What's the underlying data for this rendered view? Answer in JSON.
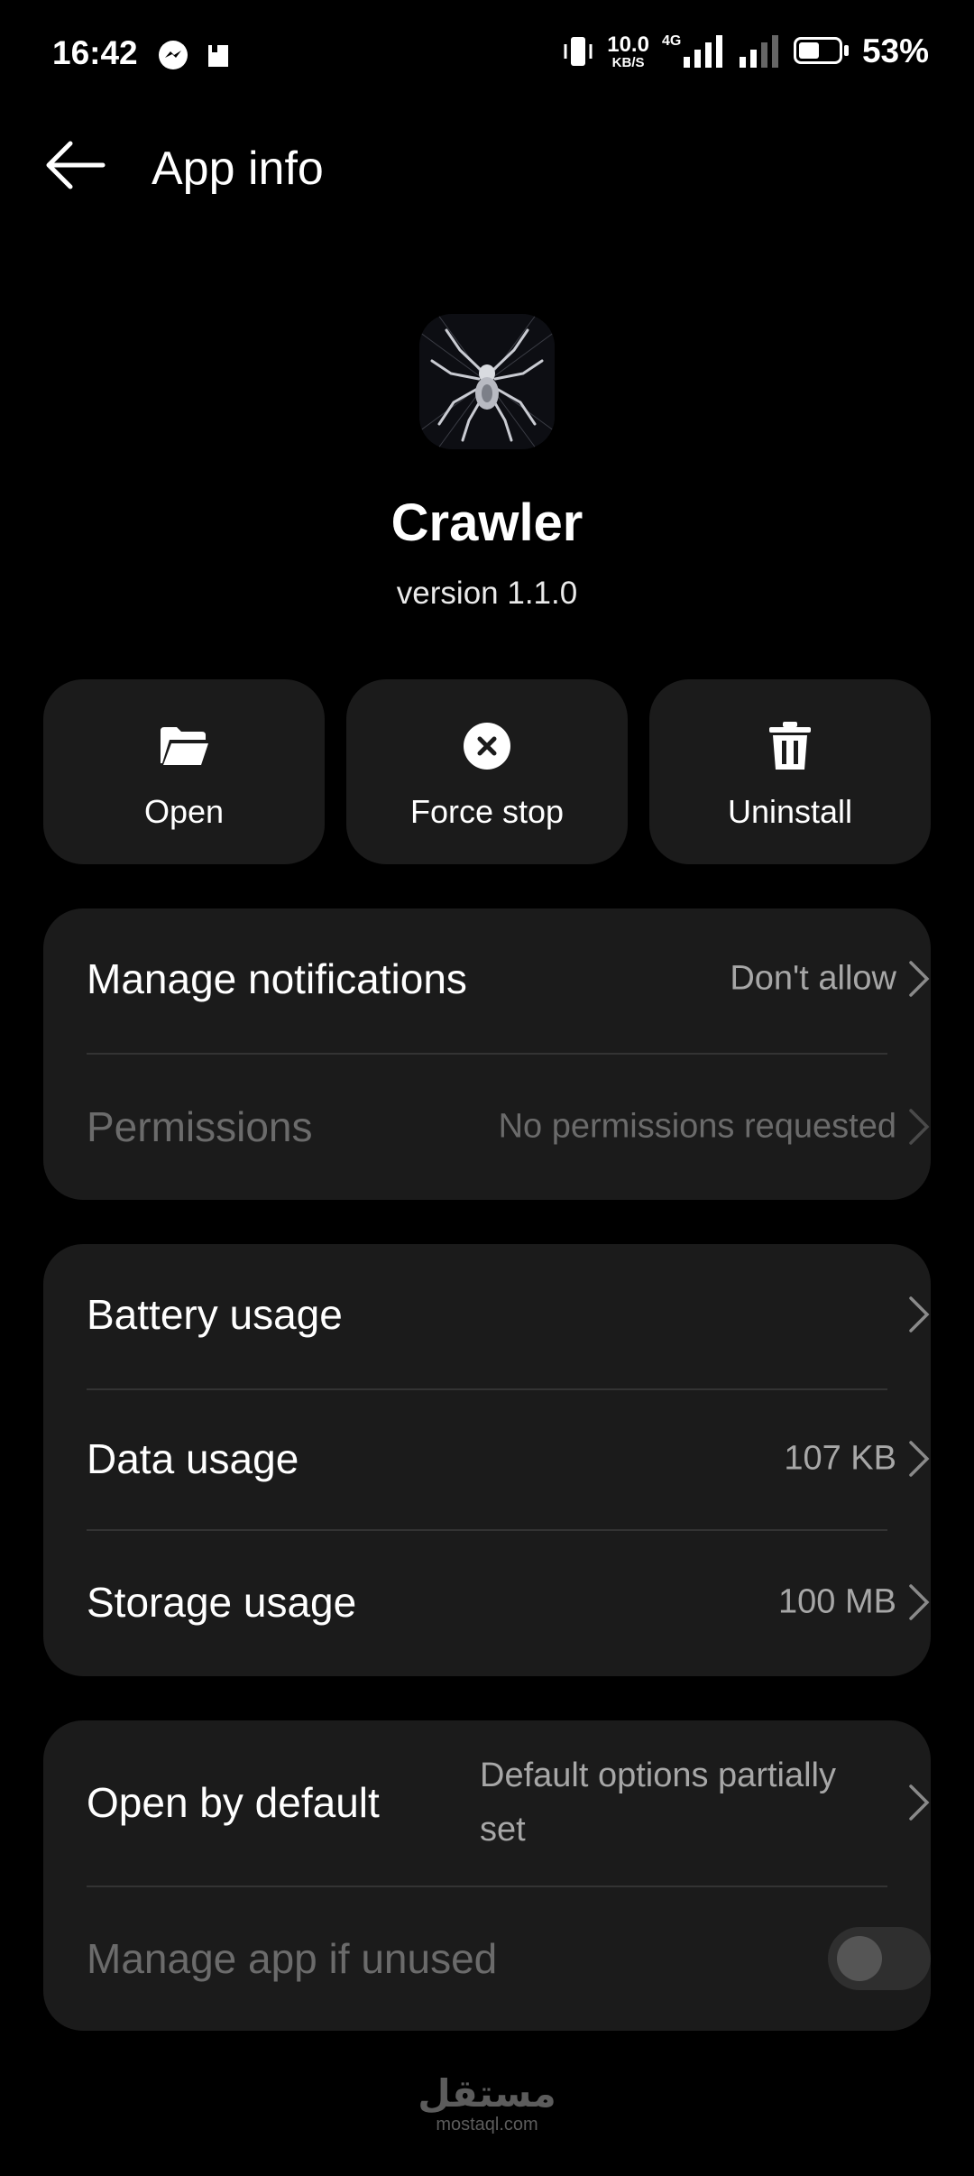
{
  "status_bar": {
    "time": "16:42",
    "left_icons": [
      "messenger-icon",
      "sim-icon"
    ],
    "net_speed_value": "10.0",
    "net_speed_unit": "KB/S",
    "network_type": "4G",
    "battery_percent": "53%",
    "battery_level": 0.53
  },
  "header": {
    "title": "App info"
  },
  "app": {
    "name": "Crawler",
    "version": "version 1.1.0",
    "icon": "spider-icon"
  },
  "actions": [
    {
      "label": "Open",
      "icon": "folder-open-icon"
    },
    {
      "label": "Force stop",
      "icon": "close-circle-icon"
    },
    {
      "label": "Uninstall",
      "icon": "trash-icon"
    }
  ],
  "card1": {
    "notifications": {
      "label": "Manage notifications",
      "value": "Don't allow"
    },
    "permissions": {
      "label": "Permissions",
      "value": "No permissions requested"
    }
  },
  "card2": {
    "battery": {
      "label": "Battery usage",
      "value": ""
    },
    "data": {
      "label": "Data usage",
      "value": "107 KB"
    },
    "storage": {
      "label": "Storage usage",
      "value": "100 MB"
    }
  },
  "card3": {
    "open_default": {
      "label": "Open by default",
      "value_line1": "Default options partially",
      "value_line2": "set"
    },
    "manage_unused": {
      "label": "Manage app if unused",
      "enabled": false
    }
  },
  "watermark": {
    "arabic": "مستقل",
    "latin": "mostaql.com"
  },
  "colors": {
    "background": "#000000",
    "card": "#1b1b1b",
    "secondary_text": "#a7a7a7",
    "disabled_text": "#6b6b6b"
  }
}
